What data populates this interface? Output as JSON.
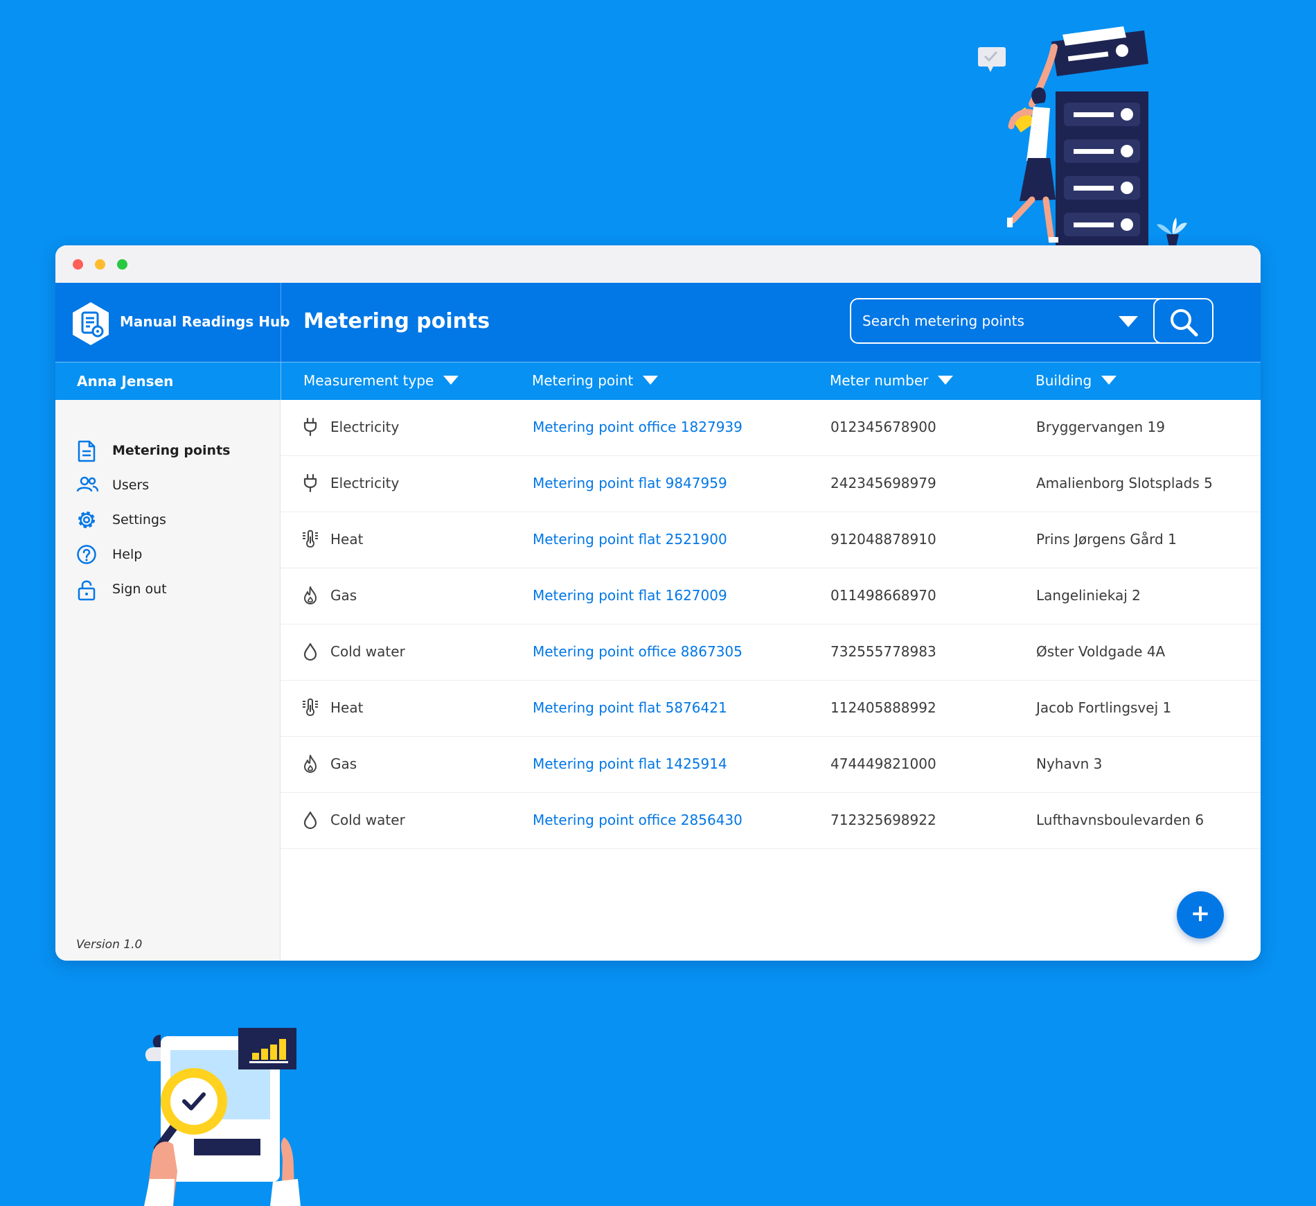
{
  "app": {
    "name": "Manual Readings Hub",
    "version": "Version 1.0"
  },
  "user": {
    "name": "Anna Jensen"
  },
  "page": {
    "title": "Metering points"
  },
  "search": {
    "placeholder": "Search metering points"
  },
  "columns": {
    "measurement_type": "Measurement type",
    "metering_point": "Metering point",
    "meter_number": "Meter number",
    "building": "Building"
  },
  "sidebar": {
    "items": [
      {
        "label": "Metering points",
        "icon": "document-icon",
        "active": true
      },
      {
        "label": "Users",
        "icon": "users-icon",
        "active": false
      },
      {
        "label": "Settings",
        "icon": "gear-icon",
        "active": false
      },
      {
        "label": "Help",
        "icon": "help-icon",
        "active": false
      },
      {
        "label": "Sign out",
        "icon": "unlock-icon",
        "active": false
      }
    ]
  },
  "rows": [
    {
      "type": "Electricity",
      "icon": "plug-icon",
      "point": "Metering point office 1827939",
      "meter": "012345678900",
      "building": "Bryggervangen 19"
    },
    {
      "type": "Electricity",
      "icon": "plug-icon",
      "point": "Metering point flat 9847959",
      "meter": "242345698979",
      "building": "Amalienborg Slotsplads 5"
    },
    {
      "type": "Heat",
      "icon": "thermometer-icon",
      "point": "Metering point flat 2521900",
      "meter": "912048878910",
      "building": "Prins Jørgens Gård 1"
    },
    {
      "type": "Gas",
      "icon": "flame-icon",
      "point": "Metering point flat 1627009",
      "meter": "011498668970",
      "building": "Langeliniekaj 2"
    },
    {
      "type": "Cold water",
      "icon": "water-drop-icon",
      "point": "Metering point office 8867305",
      "meter": "732555778983",
      "building": "Øster Voldgade 4A"
    },
    {
      "type": "Heat",
      "icon": "thermometer-icon",
      "point": "Metering point flat 5876421",
      "meter": "112405888992",
      "building": "Jacob Fortlingsvej 1"
    },
    {
      "type": "Gas",
      "icon": "flame-icon",
      "point": "Metering point flat 1425914",
      "meter": "474449821000",
      "building": "Nyhavn 3"
    },
    {
      "type": "Cold water",
      "icon": "water-drop-icon",
      "point": "Metering point office 2856430",
      "meter": "712325698922",
      "building": "Lufthavnsboulevarden 6"
    }
  ],
  "fab": {
    "label": "+"
  },
  "colors": {
    "background": "#0791F2",
    "header": "#0277e6",
    "link": "#0277e6",
    "navy": "#1e2452",
    "accent_yellow": "#ffd21f"
  }
}
